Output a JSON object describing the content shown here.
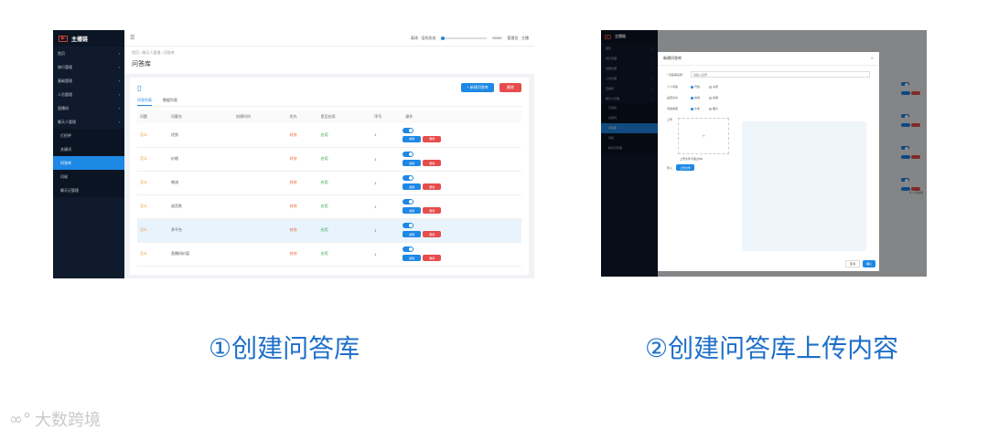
{
  "brand": "主播链",
  "screenshot1": {
    "sidebar": [
      {
        "label": "首页"
      },
      {
        "label": "商行管理"
      },
      {
        "label": "基础管理"
      },
      {
        "label": "人员管理"
      },
      {
        "label": "直播间"
      },
      {
        "label": "聊天人管理"
      }
    ],
    "submenu": [
      "打招呼",
      "关键词",
      "问答库",
      "问候",
      "聊天记管理"
    ],
    "breadcrumb": "首页 / 聊天人管理 / 问答库",
    "top_right": {
      "status": "离线 · 话机状态",
      "number": "50/50",
      "user": "管理员 · 主播"
    },
    "page_title": "问答库",
    "create_button": "+ 新建问答库",
    "delete_button": "删除",
    "tabs": [
      "问答列表",
      "数据列表"
    ],
    "columns": [
      "问题",
      "问题名",
      "创建时间",
      "优先",
      "是否启用",
      "序号",
      "操作"
    ],
    "rows": [
      {
        "q": "怎么",
        "name": "优势",
        "time": "",
        "pri": "较快",
        "enabled": "启用",
        "seq": "1"
      },
      {
        "q": "怎么",
        "name": "价格",
        "time": "",
        "pri": "较快",
        "enabled": "启用",
        "seq": "1"
      },
      {
        "q": "怎么",
        "name": "物流",
        "time": "",
        "pri": "较快",
        "enabled": "启用",
        "seq": "1"
      },
      {
        "q": "怎么",
        "name": "退货款",
        "time": "",
        "pri": "较快",
        "enabled": "启用",
        "seq": "1"
      },
      {
        "q": "怎么",
        "name": "多平台",
        "time": "",
        "pri": "较快",
        "enabled": "启用",
        "seq": "1"
      },
      {
        "q": "怎么",
        "name": "直播间价值",
        "time": "",
        "pri": "较快",
        "enabled": "启用",
        "seq": "1"
      }
    ],
    "edit_label": "编辑",
    "del_label": "删除"
  },
  "screenshot2": {
    "dialog_title": "新建问答库",
    "field_name_label": "* 问答库名称",
    "field_name_placeholder": "请输入名称",
    "radio_rows": [
      {
        "label": "个人问答",
        "opt1": "开启",
        "opt2": "关闭"
      },
      {
        "label": "是否共享",
        "opt1": "启用",
        "opt2": "禁用"
      },
      {
        "label": "问答类型",
        "opt1": "文本",
        "opt2": "图片"
      }
    ],
    "upload_label": "上传",
    "upload_hint": "上传文件不超过5M",
    "import_label": "导入",
    "import_button": "上传文件",
    "cancel": "取消",
    "confirm": "确认",
    "pager": "共 4 条数据"
  },
  "captions": {
    "first": "①创建问答库",
    "second": "②创建问答库上传内容"
  },
  "watermark": "大数跨境",
  "colors": {
    "accent": "#1e88e5",
    "danger": "#e74c4c",
    "sidebar": "#0f1b2d",
    "caption": "#1e6fc9"
  }
}
